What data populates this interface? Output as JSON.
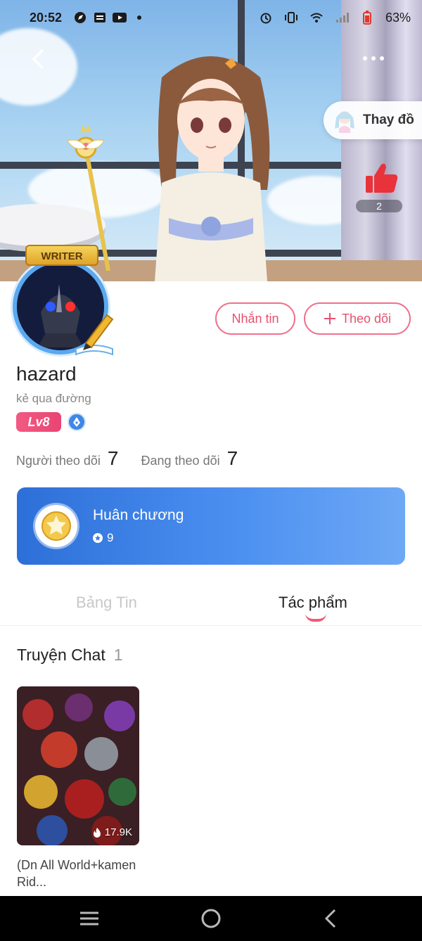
{
  "status_bar": {
    "time": "20:52",
    "battery": "63%"
  },
  "header": {
    "change_outfit_label": "Thay đồ",
    "like_count": "2"
  },
  "badge": {
    "writer_label": "WRITER"
  },
  "profile": {
    "username": "hazard",
    "bio": "kẻ qua đường",
    "level": "Lv8",
    "followers_label": "Người theo dõi",
    "followers_count": "7",
    "following_label": "Đang theo dõi",
    "following_count": "7"
  },
  "actions": {
    "message_label": "Nhắn tin",
    "follow_label": "Theo dõi"
  },
  "medal": {
    "title": "Huân chương",
    "count": "9"
  },
  "tabs": [
    {
      "label": "Bảng Tin",
      "active": false
    },
    {
      "label": "Tác phẩm",
      "active": true
    }
  ],
  "works": {
    "section_title": "Truyện Chat",
    "section_count": "1",
    "items": [
      {
        "title": "(Dn All World+kamen Rid...",
        "views": "17.9K"
      }
    ]
  },
  "colors": {
    "accent": "#e7506f",
    "medal_card": "#3b7fe4",
    "level_badge": "#ee4f7a"
  },
  "icons": {
    "back": "chevron-left-icon",
    "more": "more-dots-icon",
    "like": "thumbs-up-icon",
    "plus": "plus-icon",
    "medal": "medal-icon",
    "views": "fire-icon"
  }
}
